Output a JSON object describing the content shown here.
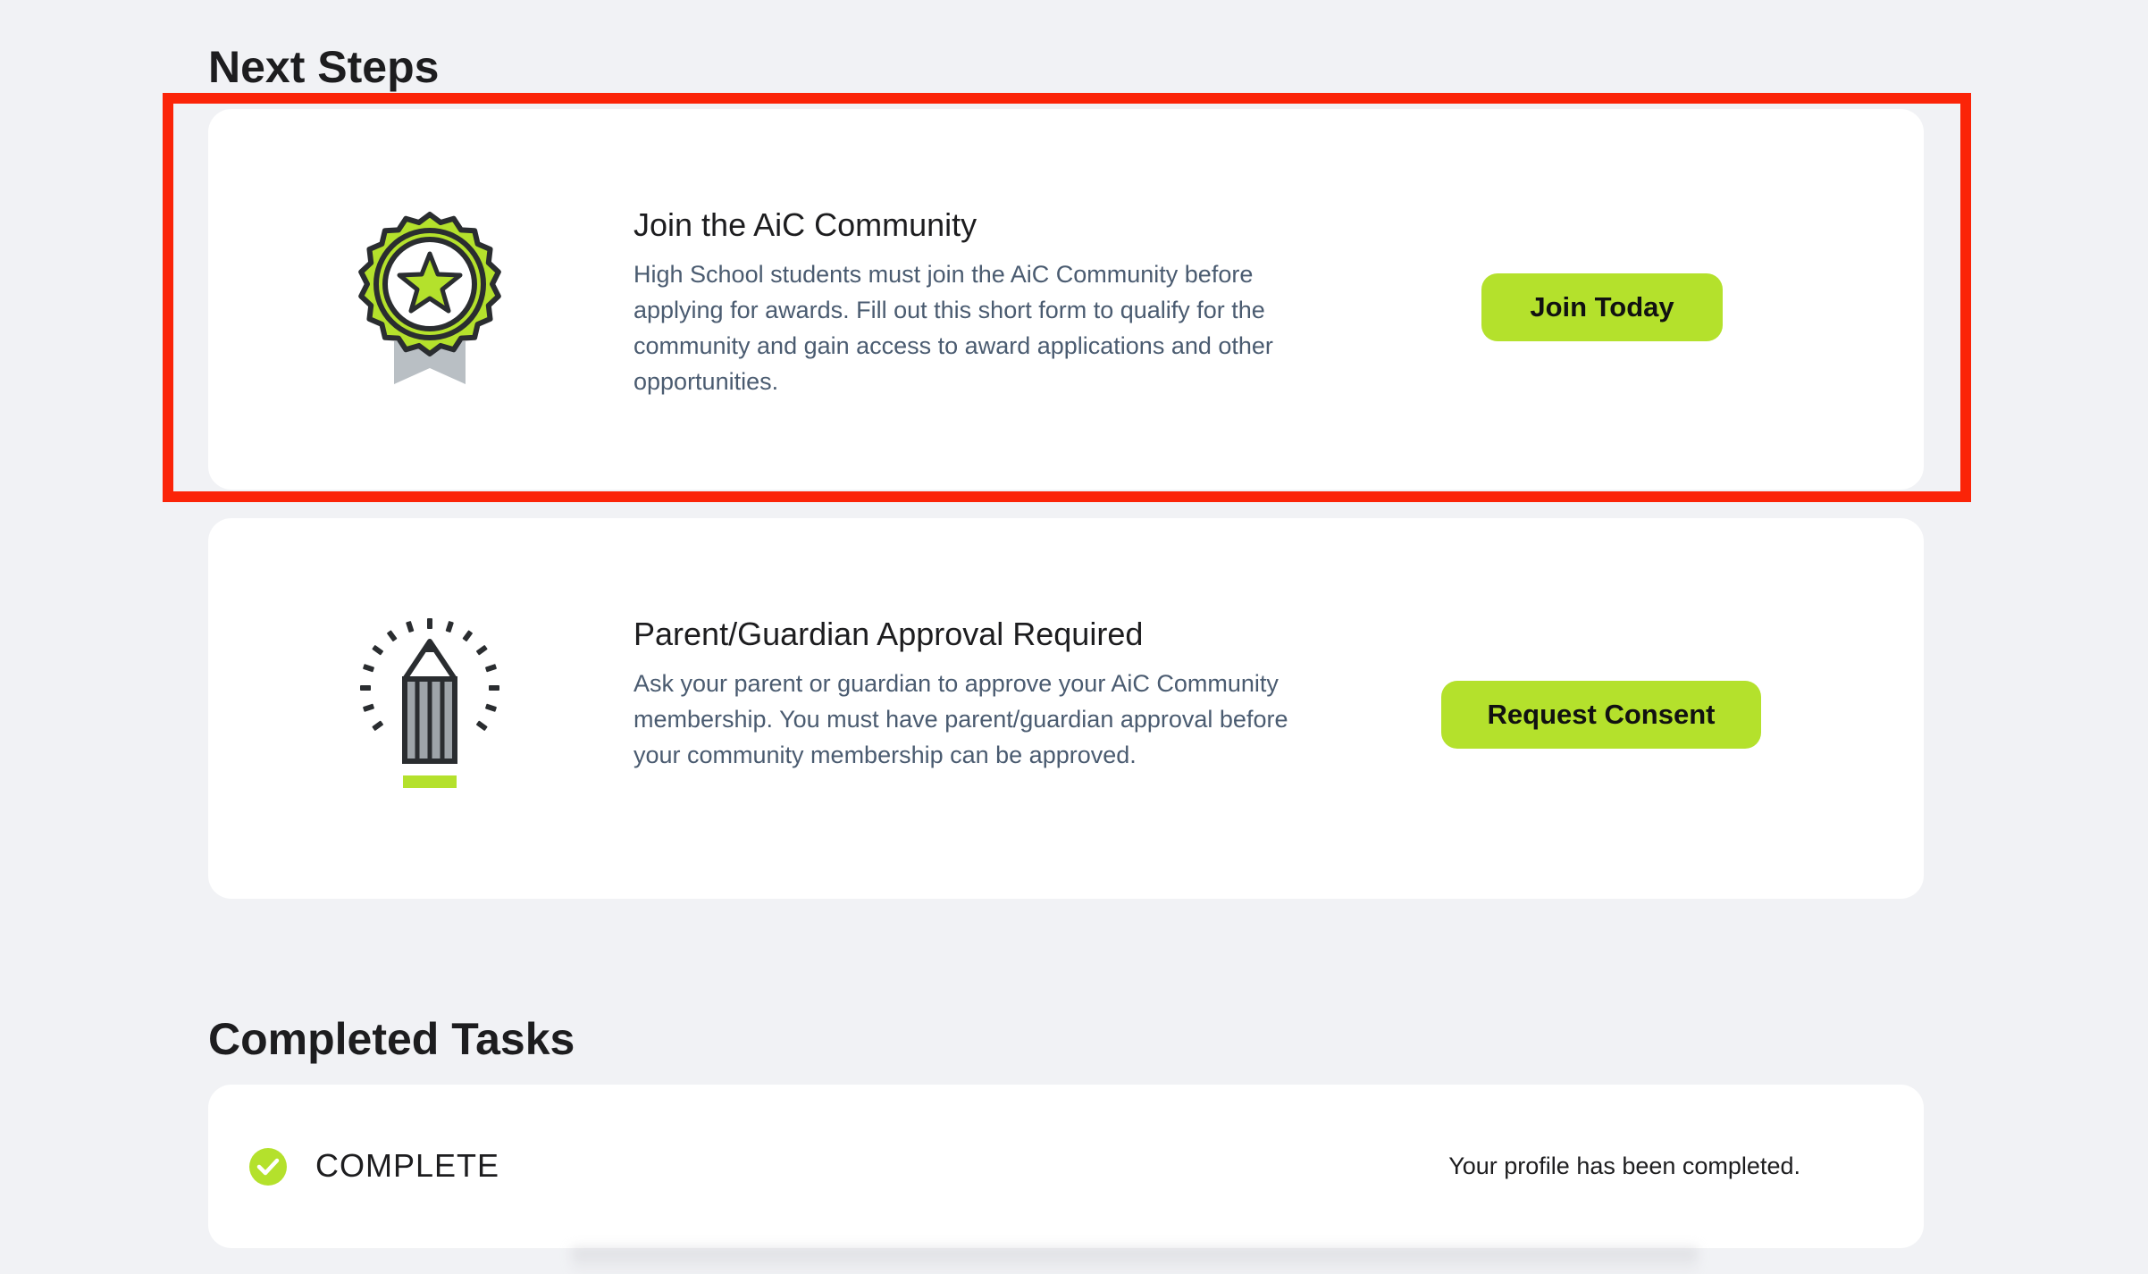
{
  "next_steps": {
    "title": "Next Steps",
    "cards": [
      {
        "heading": "Join the AiC Community",
        "description": "High School students must join the AiC Community before applying for awards. Fill out this short form to qualify for the community and gain access to award applications and other opportunities.",
        "button_label": "Join Today",
        "icon": "award-badge-icon"
      },
      {
        "heading": "Parent/Guardian Approval Required",
        "description": "Ask your parent or guardian to approve your AiC Community membership. You must have parent/guardian approval before your community membership can be approved.",
        "button_label": "Request Consent",
        "icon": "pencil-icon"
      }
    ]
  },
  "completed_tasks": {
    "title": "Completed Tasks",
    "items": [
      {
        "status": "COMPLETE",
        "message": "Your profile has been completed.",
        "icon": "check-circle-icon"
      }
    ]
  },
  "colors": {
    "accent": "#b4e12c",
    "highlight": "#fb2408",
    "background": "#f1f2f5",
    "card": "#ffffff",
    "text_dark": "#1d1d1f",
    "text_muted": "#4a5b70"
  }
}
